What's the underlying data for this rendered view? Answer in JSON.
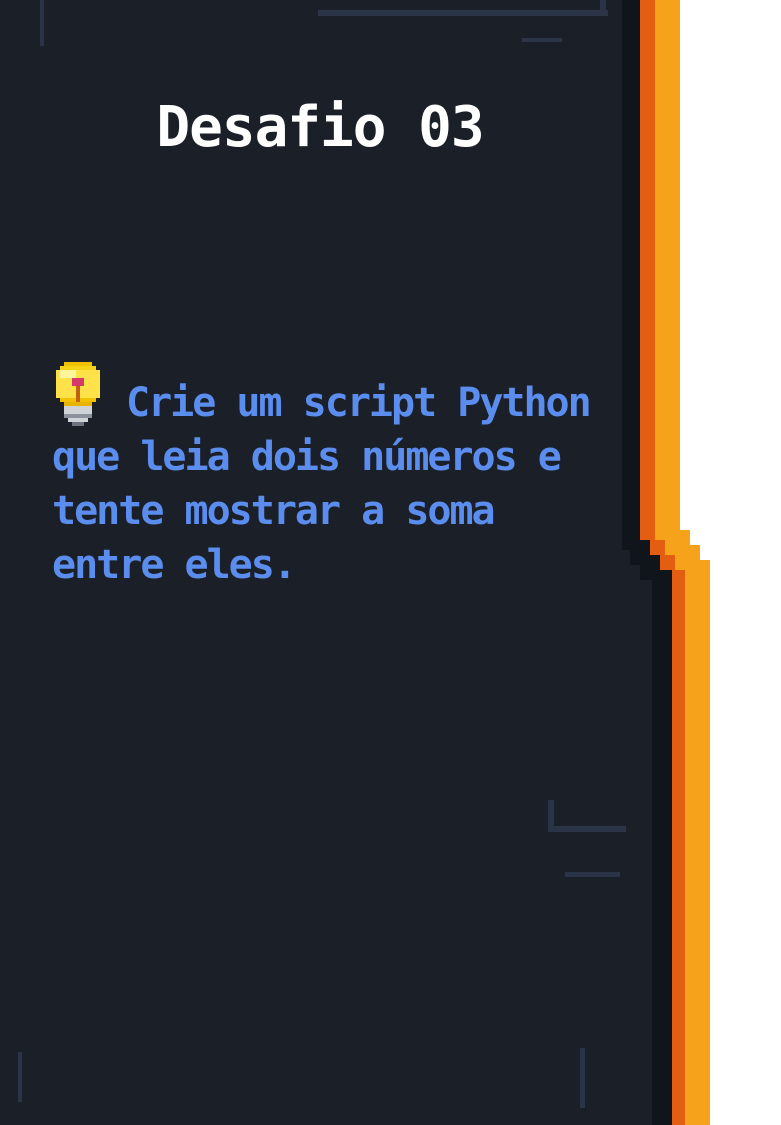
{
  "slide": {
    "title": "Desafio 03",
    "icon": "lightbulb-icon",
    "body": "Crie um script Python que leia dois números e tente mostrar a soma entre eles."
  },
  "colors": {
    "panel": "#1b1f27",
    "accent_orange": "#f7a21b",
    "accent_dark_orange": "#e35e10",
    "text_title": "#ffffff",
    "text_body": "#5b8def",
    "outer_background": "#ffffff"
  }
}
